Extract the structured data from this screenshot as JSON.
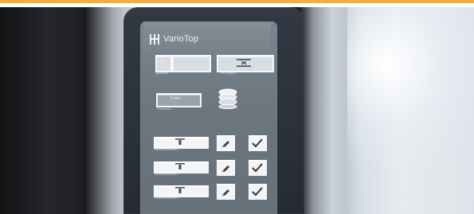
{
  "scene": {
    "brand": "VarioTop"
  },
  "colors": {
    "accent": "#f8ae2d",
    "screen": "#6f7a83",
    "frame": "#262b33",
    "button": "#f3f5f7"
  },
  "screen": {
    "controls": {
      "quantity_box": {
        "value": "1",
        "label": "Quantity"
      },
      "height_box": {
        "label": "Set height"
      },
      "thickness_box": {
        "value": "0 mm",
        "label": "Thickness"
      }
    },
    "rows": [
      {
        "label": "Favourite position 1"
      },
      {
        "label": "Favourite position 2"
      },
      {
        "label": "Favourite position 3"
      }
    ]
  },
  "icons": {
    "logo": "brand-icon",
    "height": "height-adjust-icon",
    "stack": "stack-icon",
    "edit": "edit-icon",
    "check": "check-icon",
    "row_glyph": "position-icon"
  }
}
